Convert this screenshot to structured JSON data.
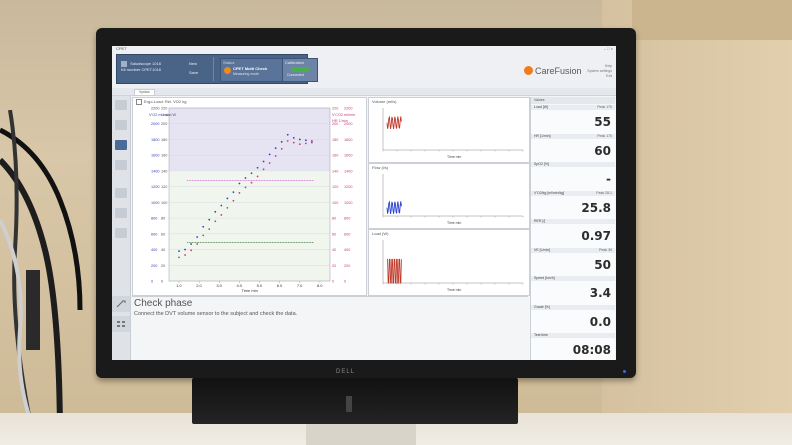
{
  "window": {
    "title": "CPET",
    "buttons": "– □ ×"
  },
  "header": {
    "user_line1": "Saludscope 1016",
    "user_line2": "Kit number CPET1016",
    "btn_new": "New",
    "btn_save": "Save",
    "status_title": "Status",
    "status_main": "CPET Multi Check",
    "status_sub": "Measuring mode",
    "calib_title": "Calibration",
    "calib_sub": "Connected",
    "logo": "CareFusion",
    "right_line1": "Help",
    "right_line2": "System settings",
    "right_line3": "Exit"
  },
  "tab": {
    "label": "Vyntus"
  },
  "main_chart": {
    "title": "Ergo-Load: Rel. VO2 kg",
    "xlabel": "Time min",
    "left_labels": [
      "V'O2 ml/min",
      "Load W"
    ],
    "right_labels": [
      "V'CO2 ml/min",
      "HR 1/min"
    ]
  },
  "chart_data": {
    "type": "scatter",
    "title": "Ergo-Load: Rel. VO2 kg",
    "xlabel": "Time min",
    "xlim": [
      0.5,
      8.5
    ],
    "xticks": [
      "1.0",
      "2.0",
      "3.0",
      "4.0",
      "5.0",
      "6.0",
      "7.0",
      "8.0"
    ],
    "y_outer_left_ticks": [
      "0",
      "200",
      "400",
      "600",
      "800",
      "1000",
      "1200",
      "1400",
      "1600",
      "1800",
      "2000",
      "2200"
    ],
    "y_inner_left_ticks": [
      "0",
      "20",
      "40",
      "60",
      "80",
      "100",
      "120",
      "140",
      "160",
      "180",
      "200",
      "220"
    ],
    "y_inner_right_ticks": [
      "0",
      "20",
      "40",
      "60",
      "80",
      "100",
      "120",
      "140",
      "160",
      "180",
      "200",
      "220"
    ],
    "y_outer_right_ticks": [
      "0",
      "200",
      "400",
      "600",
      "800",
      "1000",
      "1200",
      "1400",
      "1600",
      "1800",
      "2000",
      "2200"
    ],
    "ylim": [
      0,
      2200
    ],
    "series": [
      {
        "name": "V'O2",
        "color": "#2a3fd0",
        "x": [
          1.0,
          1.3,
          1.6,
          1.9,
          2.2,
          2.5,
          2.8,
          3.1,
          3.4,
          3.7,
          4.0,
          4.3,
          4.6,
          4.9,
          5.2,
          5.5,
          5.8,
          6.1,
          6.4,
          6.7,
          7.0,
          7.3,
          7.6
        ],
        "y": [
          380,
          400,
          470,
          560,
          690,
          780,
          880,
          960,
          1050,
          1130,
          1240,
          1310,
          1370,
          1440,
          1520,
          1610,
          1690,
          1770,
          1860,
          1820,
          1800,
          1790,
          1780
        ]
      },
      {
        "name": "V'CO2",
        "color": "#c63d7a",
        "x": [
          1.0,
          1.3,
          1.6,
          1.9,
          2.2,
          2.5,
          2.8,
          3.1,
          3.4,
          3.7,
          4.0,
          4.3,
          4.6,
          4.9,
          5.2,
          5.5,
          5.8,
          6.1,
          6.4,
          6.7,
          7.0,
          7.3,
          7.6
        ],
        "y": [
          300,
          330,
          390,
          470,
          580,
          660,
          760,
          840,
          930,
          1020,
          1120,
          1190,
          1250,
          1330,
          1420,
          1500,
          1590,
          1680,
          1780,
          1760,
          1740,
          1750,
          1760
        ]
      },
      {
        "name": "Load",
        "color": "#d25fd2",
        "x": [
          1.4,
          7.7
        ],
        "y": [
          1280,
          1280
        ]
      },
      {
        "name": "HR",
        "color": "#3a7a3a",
        "x": [
          1.4,
          7.7
        ],
        "y": [
          490,
          490
        ]
      }
    ]
  },
  "mini_charts": [
    {
      "title": "Volume (ml/s)",
      "xlabel": "Time min",
      "color": "#c0392b"
    },
    {
      "title": "Flow (l/s)",
      "xlabel": "Time min",
      "color": "#2a3fd0"
    },
    {
      "title": "Load (W)",
      "xlabel": "Time min",
      "color": "#c0392b"
    }
  ],
  "right_panel": {
    "title": "Values",
    "metrics": [
      {
        "label": "Load [W]",
        "peak": "Peak 170",
        "value": "55"
      },
      {
        "label": "HR [1/min]",
        "peak": "Peak 170",
        "value": "60"
      },
      {
        "label": "SpO2 [%]",
        "peak": "",
        "value": "-"
      },
      {
        "label": "V'O2/kg [ml/min/kg]",
        "peak": "Peak 28.1",
        "value": "25.8"
      },
      {
        "label": "RER [/]",
        "peak": "",
        "value": "0.97"
      },
      {
        "label": "VE [L/min]",
        "peak": "Peak 39",
        "value": "50"
      },
      {
        "label": "Speed [km/h]",
        "peak": "",
        "value": "3.4"
      },
      {
        "label": "Grade [%]",
        "peak": "",
        "value": "0.0"
      },
      {
        "label": "Test time",
        "peak": "",
        "value": "08:08"
      }
    ]
  },
  "check": {
    "title": "Check phase",
    "message": "Connect the DVT volume sensor to the subject and check the data."
  },
  "monitor_brand": "DELL"
}
